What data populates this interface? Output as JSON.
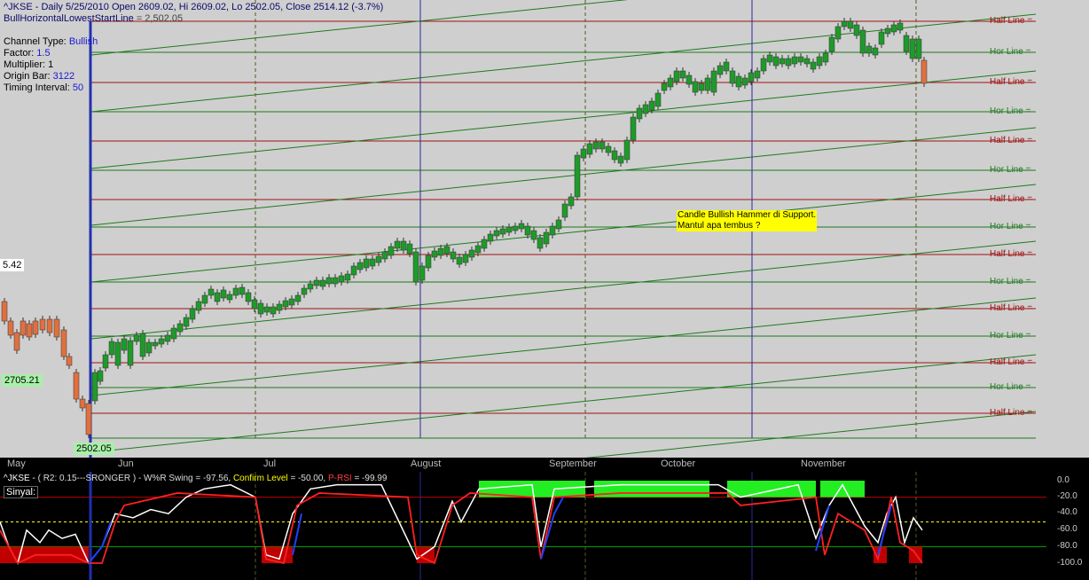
{
  "header": {
    "title": "^JKSE - Daily 5/25/2010 Open 2609.02, Hi 2609.02, Lo 2502.05, Close 2514.12 (-3.7%)",
    "subtitle_label": "BullHorizontalLowestStartLine",
    "subtitle_value": "= 2,502.05"
  },
  "info": {
    "channel_type_label": "Channel Type:",
    "channel_type_value": "Bullish",
    "factor_label": "Factor:",
    "factor_value": "1.5",
    "multiplier_label": "Multiplier:",
    "multiplier_value": "1",
    "origin_bar_label": "Origin Bar:",
    "origin_bar_value": "3122",
    "timing_label": "Timing Interval:",
    "timing_value": "50"
  },
  "price_labels": {
    "left_partial": "5.42",
    "mid": "2705.21",
    "low": "2502.05"
  },
  "right_labels": [
    {
      "text": "Half Line =",
      "kind": "half"
    },
    {
      "text": "Hor Line =",
      "kind": "hor"
    },
    {
      "text": "Half Line =",
      "kind": "half"
    },
    {
      "text": "Hor Line =",
      "kind": "hor"
    },
    {
      "text": "Half Line =",
      "kind": "half"
    },
    {
      "text": "Hor Line =",
      "kind": "hor"
    },
    {
      "text": "Half Line =",
      "kind": "half"
    },
    {
      "text": "Hor Line =",
      "kind": "hor"
    },
    {
      "text": "Half Line =",
      "kind": "half"
    },
    {
      "text": "Hor Line =",
      "kind": "hor"
    },
    {
      "text": "Half Line =",
      "kind": "half"
    },
    {
      "text": "Hor Line =",
      "kind": "hor"
    },
    {
      "text": "Half Line =",
      "kind": "half"
    },
    {
      "text": "Hor Line =",
      "kind": "hor"
    },
    {
      "text": "Half Line =",
      "kind": "half"
    }
  ],
  "annotation": {
    "line1": "Candle Bullish Hammer di Support.",
    "line2": "Mantul apa tembus ?"
  },
  "months": [
    "May",
    "Jun",
    "Jul",
    "August",
    "September",
    "October",
    "November"
  ],
  "indicator": {
    "symbol": "^JKSE -",
    "params": "( R2: 0.15---SRONGER ) - W%R Swing",
    "wr_value": "= -97.56,",
    "confirm_label": "Confirm Level",
    "confirm_value": "= -50.00,",
    "prsi_label": "P-RSI",
    "prsi_value": "= -99.99",
    "sinyal_label": "Sinyal:",
    "y_ticks": [
      "0.0",
      "-20.0",
      "-40.0",
      "-60.0",
      "-80.0",
      "-100.0"
    ]
  },
  "colors": {
    "chart_bg": "#cfcfcf",
    "hor_line": "#1e7a1e",
    "half_line": "#a01010",
    "bull_candle": "#1f9a2a",
    "bear_candle": "#e07040",
    "timing_line": "#2a2a9a",
    "wr_fill_green": "#22ee22",
    "wr_fill_red": "#c00000",
    "wr_line_white": "#ffffff",
    "prsi_line_red": "#ff2020",
    "prsi_line_blue": "#2040ff"
  },
  "chart_data": {
    "type": "candlestick",
    "title": "^JKSE - Daily 5/25/2010 Open 2609.02, Hi 2609.02, Lo 2502.05, Close 2514.12 (-3.7%)",
    "last_bar": {
      "date": "5/25/2010",
      "open": 2609.02,
      "high": 2609.02,
      "low": 2502.05,
      "close": 2514.12,
      "change_pct": -3.7
    },
    "bull_horizontal_lowest_start_line": 2502.05,
    "marked_prices": [
      2502.05,
      2705.21
    ],
    "x_categories": [
      "May",
      "Jun",
      "Jul",
      "August",
      "September",
      "October",
      "November"
    ],
    "indicator": {
      "name": "W%R Swing",
      "wr_value": -97.56,
      "confirm_level": -50.0,
      "p_rsi": -99.99,
      "ylim": [
        -100,
        0
      ]
    }
  }
}
